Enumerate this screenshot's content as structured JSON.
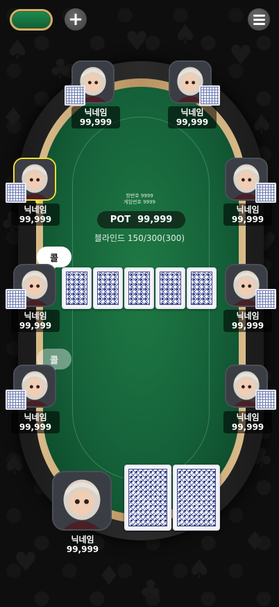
{
  "top_bar": {
    "chip_pill_icon": "green-pill",
    "add_icon": "plus-icon",
    "add_symbol": "+",
    "menu_icon": "hamburger-icon"
  },
  "table": {
    "room_number": "방번호 9999",
    "game_number": "게임번호 9999",
    "pot_label": "POT",
    "pot_value": "99,999",
    "blinds": "블라인드 150/300(300)"
  },
  "seats": [
    {
      "id": "top-left",
      "name": "닉네임",
      "chips": "99,999"
    },
    {
      "id": "top-right",
      "name": "닉네임",
      "chips": "99,999"
    },
    {
      "id": "upper-left",
      "name": "닉네임",
      "chips": "99,999",
      "is_turn": true
    },
    {
      "id": "upper-right",
      "name": "닉네임",
      "chips": "99,999"
    },
    {
      "id": "mid-left",
      "name": "닉네임",
      "chips": "99,999",
      "bubble": "콜"
    },
    {
      "id": "mid-right",
      "name": "닉네임",
      "chips": "99,999"
    },
    {
      "id": "lower-left",
      "name": "닉네임",
      "chips": "99,999",
      "bubble": "콜"
    },
    {
      "id": "lower-right",
      "name": "닉네임",
      "chips": "99,999"
    }
  ],
  "self": {
    "name": "닉네임",
    "chips": "99,999"
  },
  "community_cards_count": 5,
  "colors": {
    "felt": "#15623a",
    "rail": "#1f1f1f",
    "wood": "#c9a571",
    "turn_ring": "#f0e12a"
  }
}
